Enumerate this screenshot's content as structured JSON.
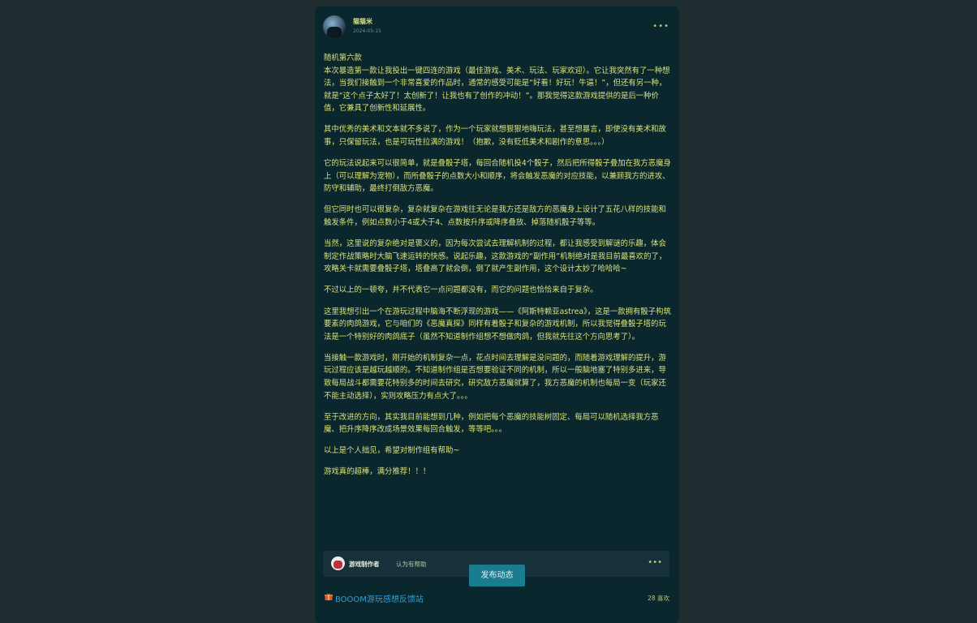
{
  "post": {
    "author": "猫猫米",
    "date": "2024-05-15",
    "more": "•••",
    "paragraphs": [
      "随机第六款\n本次暴造第一款让我投出一键四连的游戏（最佳游戏、美术、玩法、玩家欢迎）。它让我突然有了一种想法，当我们接触到一个非常喜爱的作品时，通常的感受可能是“好看！好玩！牛逼！”，但还有另一种，就是“这个点子太好了！太创新了！让我也有了创作的冲动！”。那我觉得这款游戏提供的是后一种价值，它兼具了创新性和延展性。",
      "其中优秀的美术和文本就不多说了，作为一个玩家就想狠狠地嗨玩法，甚至想暴言，即使没有美术和故事，只保留玩法，也是可玩性拉满的游戏！（抱歉，没有贬低美术和剧作的意思。。。）",
      "它的玩法说起来可以很简单，就是叠骰子塔，每回合随机投4个骰子，然后把所得骰子叠加在我方恶魔身上（可以理解为宠物），而所叠骰子的点数大小和顺序，将会触发恶魔的对应技能，以兼顾我方的进攻、防守和辅助，最终打倒敌方恶魔。",
      "但它同时也可以很复杂，复杂就复杂在游戏往无论是我方还是敌方的恶魔身上设计了五花八样的技能和触发条件，例如点数小于4或大于4、点数按升序或降序叠放、掉落随机骰子等等。",
      "当然，这里说的复杂绝对是褒义的，因为每次尝试去理解机制的过程，都让我感受到解谜的乐趣，体会制定作战策略时大脑飞速运转的快感。说起乐趣，这款游戏的“副作用”机制绝对是我目前最喜欢的了，攻略关卡就需要叠骰子塔，塔叠高了就会倒，倒了就产生副作用，这个设计太妙了哈哈哈~",
      "不过以上的一顿夸，并不代表它一点问题都没有，而它的问题也恰恰来自于复杂。",
      "这里我想引出一个在游玩过程中脑海不断浮现的游戏——《阿斯特赖亚astrea》，这是一款拥有骰子构筑要素的肉鸽游戏，它与咱们的《恶魔真探》同样有着骰子和复杂的游戏机制，所以我觉得叠骰子塔的玩法是一个特别好的肉鸽底子（虽然不知道制作组想不想做肉鸽，但我就先往这个方向思考了）。",
      "当接触一款游戏时，刚开始的机制复杂一点，花点时间去理解是没问题的，而随着游戏理解的提升，游玩过程应该是越玩越顺的。不知道制作组是否想要验证不同的机制，所以一般脑地塞了特别多进来，导致每局战斗都需要花特别多的时间去研究，研究敌方恶魔就算了，我方恶魔的机制也每局一变（玩家还不能主动选择），实则攻略压力有点大了。。。",
      "至于改进的方向，其实我目前能想到几种，例如把每个恶魔的技能树固定、每局可以随机选择我方恶魔、把升序降序改成场景效果每回合触发，等等吧。。。",
      "以上是个人拙见，希望对制作组有帮助~",
      "游戏真的超棒，满分推荐！！！"
    ]
  },
  "helpful": {
    "name": "游戏制作者",
    "text": "认为有帮助",
    "more": "•••"
  },
  "publish_button": "发布动态",
  "footer": {
    "tag": "BOOOM游玩感想反馈站",
    "likes": "28 喜欢"
  },
  "colors": {
    "background": "#1f2c30",
    "card": "#0b272e",
    "text": "#d8e27a",
    "accent": "#1a7c8f",
    "tag": "#2f9fd0"
  }
}
